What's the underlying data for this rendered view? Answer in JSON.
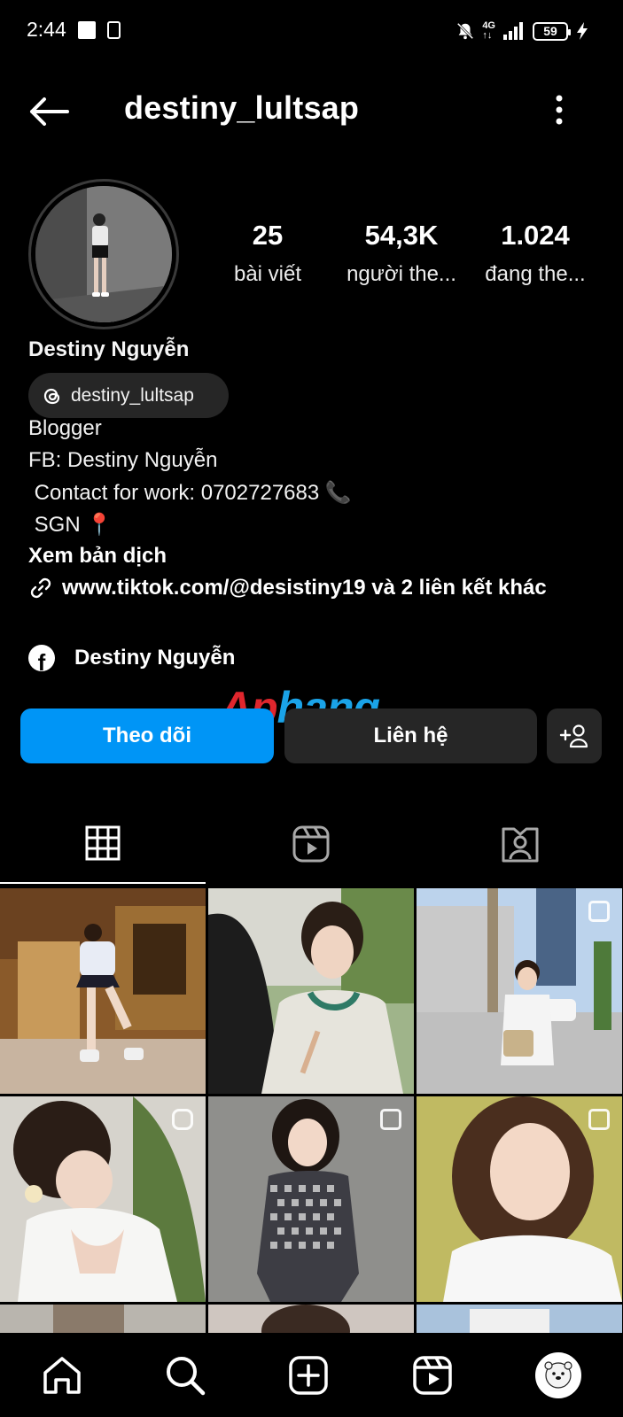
{
  "status_bar": {
    "time": "2:44",
    "network": "4G",
    "battery": "59"
  },
  "header": {
    "username": "destiny_lultsap"
  },
  "stats": [
    {
      "value": "25",
      "label": "bài viết"
    },
    {
      "value": "54,3K",
      "label": "người the..."
    },
    {
      "value": "1.024",
      "label": "đang the..."
    }
  ],
  "profile": {
    "name": "Destiny Nguyễn",
    "threads_handle": "destiny_lultsap",
    "bio": [
      "Blogger",
      "FB: Destiny Nguyễn",
      " Contact for work: 0702727683 📞",
      " SGN 📍"
    ],
    "see_translation": "Xem bản dịch",
    "link": "www.tiktok.com/@desistiny19 và 2 liên kết khác",
    "facebook_name": "Destiny Nguyễn"
  },
  "watermark": "Aphang",
  "buttons": {
    "follow": "Theo dõi",
    "contact": "Liên hệ"
  },
  "icons": [
    "back-arrow-icon",
    "more-vertical-icon",
    "threads-icon",
    "link-icon",
    "facebook-icon",
    "add-person-icon",
    "grid-icon",
    "reels-icon",
    "tagged-icon",
    "home-icon",
    "search-icon",
    "create-icon",
    "profile-icon"
  ],
  "colors": {
    "accent": "#0095f6",
    "background": "#000000",
    "chip": "#262626"
  }
}
